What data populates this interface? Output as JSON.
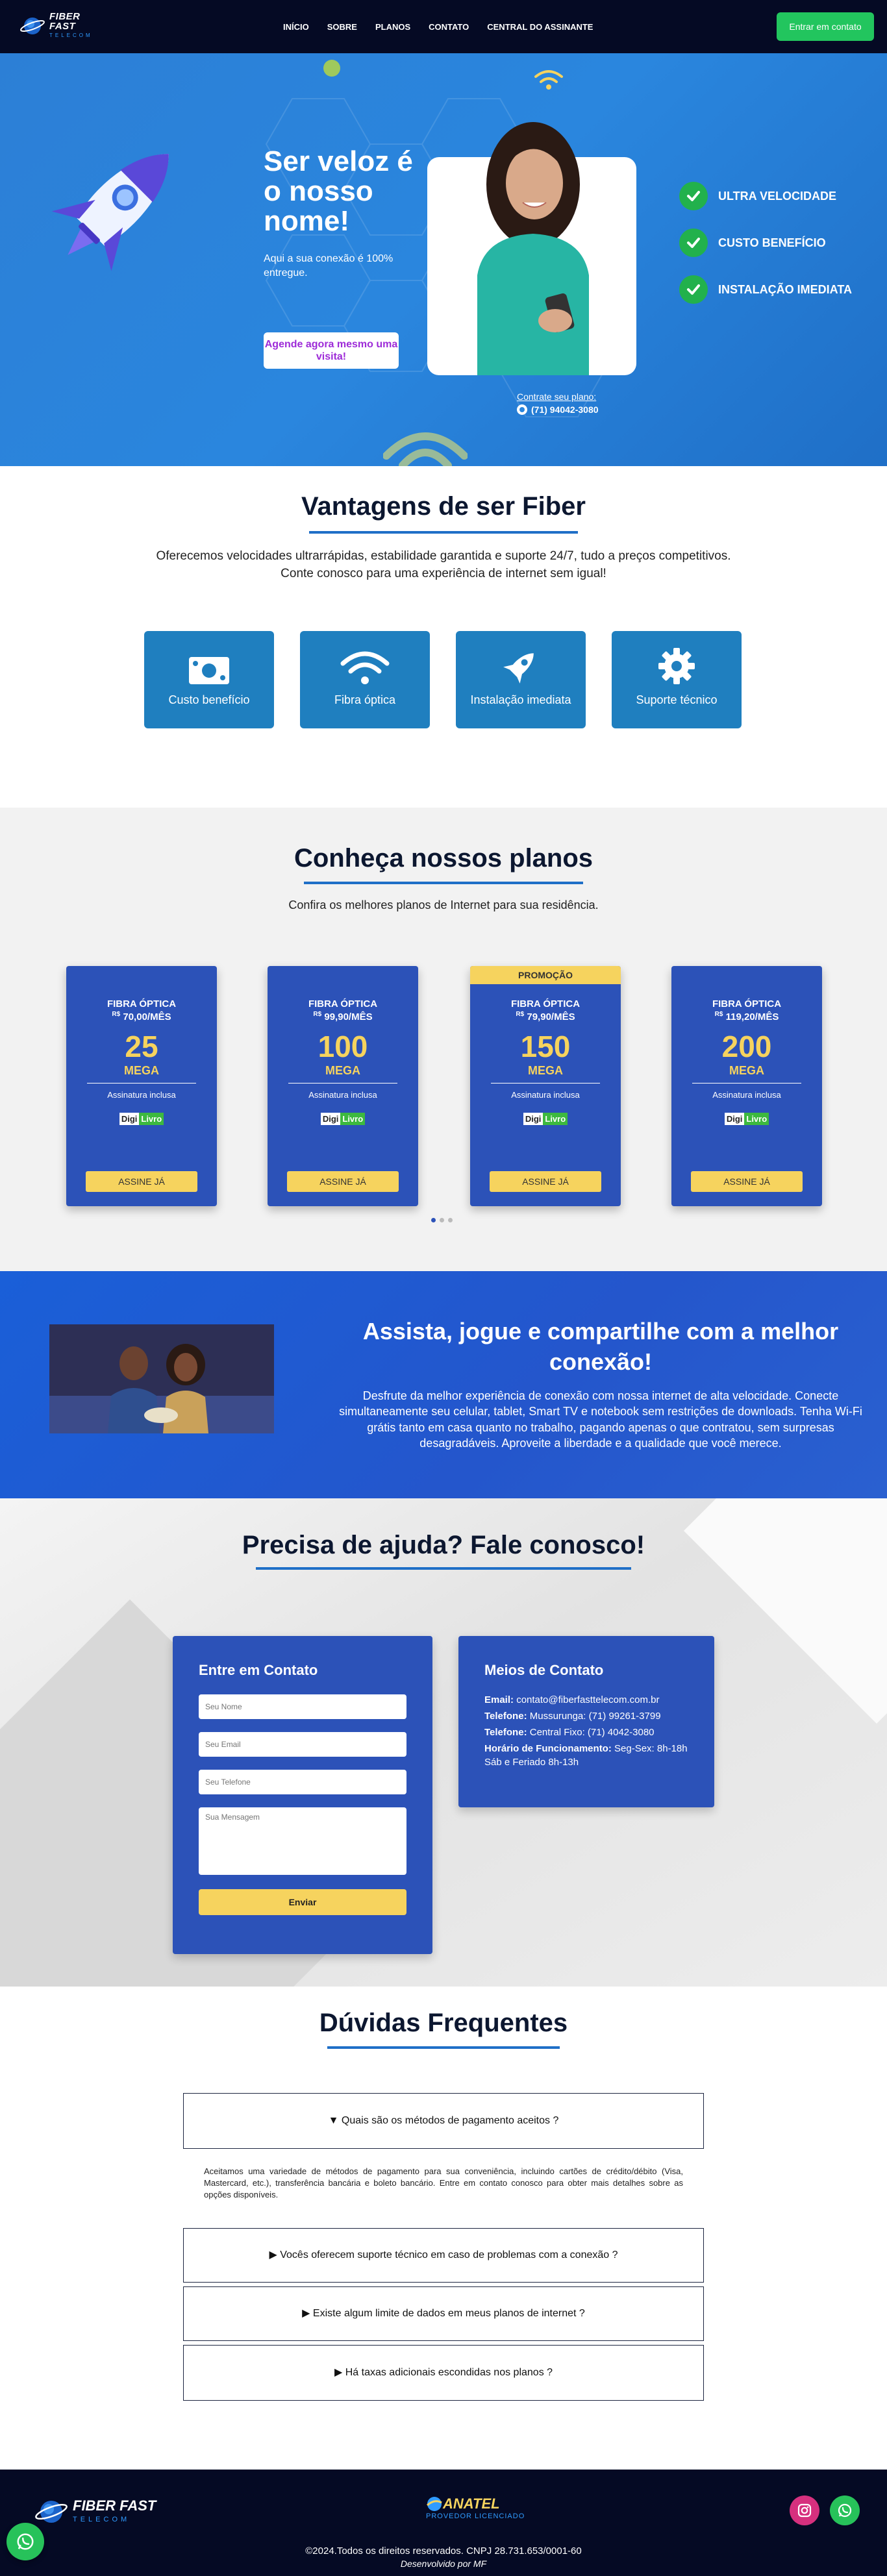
{
  "nav": {
    "logo_line1": "FIBER FAST",
    "logo_line2": "TELECOM",
    "links": [
      "INÍCIO",
      "SOBRE",
      "PLANOS",
      "CONTATO",
      "CENTRAL DO ASSINANTE"
    ],
    "cta": "Entrar em contato"
  },
  "hero": {
    "title": "Ser veloz é o nosso nome!",
    "subtitle": "Aqui a sua conexão é 100% entregue.",
    "button": "Agende agora mesmo uma visita!",
    "contract_label": "Contrate seu plano:",
    "phone": "(71) 94042-3080",
    "features": [
      "ULTRA VELOCIDADE",
      "CUSTO BENEFÍCIO",
      "INSTALAÇÃO IMEDIATA"
    ]
  },
  "vantagens": {
    "title": "Vantagens de ser Fiber",
    "text_line1": "Oferecemos velocidades ultrarrápidas, estabilidade garantida e suporte 24/7, tudo a preços competitivos.",
    "text_line2": "Conte conosco para uma experiência de internet sem igual!",
    "cards": [
      {
        "label": "Custo benefício",
        "icon": "money-icon"
      },
      {
        "label": "Fibra óptica",
        "icon": "wifi-icon"
      },
      {
        "label": "Instalação imediata",
        "icon": "rocket-icon"
      },
      {
        "label": "Suporte técnico",
        "icon": "gear-icon"
      }
    ]
  },
  "planos": {
    "title": "Conheça nossos planos",
    "subtitle": "Confira os melhores planos de Internet para sua residência.",
    "items": [
      {
        "type": "FIBRA ÓPTICA",
        "currency": "R$",
        "price": "70,00/MÊS",
        "speed": "25",
        "unit": "MEGA",
        "extra": "Assinatura inclusa",
        "digi1": "Digi",
        "digi2": "Livro",
        "button": "ASSINE JÁ",
        "promo": ""
      },
      {
        "type": "FIBRA ÓPTICA",
        "currency": "R$",
        "price": "99,90/MÊS",
        "speed": "100",
        "unit": "MEGA",
        "extra": "Assinatura inclusa",
        "digi1": "Digi",
        "digi2": "Livro",
        "button": "ASSINE JÁ",
        "promo": ""
      },
      {
        "type": "FIBRA ÓPTICA",
        "currency": "R$",
        "price": "79,90/MÊS",
        "speed": "150",
        "unit": "MEGA",
        "extra": "Assinatura inclusa",
        "digi1": "Digi",
        "digi2": "Livro",
        "button": "ASSINE JÁ",
        "promo": "PROMOÇÃO"
      },
      {
        "type": "FIBRA ÓPTICA",
        "currency": "R$",
        "price": "119,20/MÊS",
        "speed": "200",
        "unit": "MEGA",
        "extra": "Assinatura inclusa",
        "digi1": "Digi",
        "digi2": "Livro",
        "button": "ASSINE JÁ",
        "promo": ""
      }
    ]
  },
  "assista": {
    "title": "Assista, jogue e compartilhe com a melhor conexão!",
    "text": "Desfrute da melhor experiência de conexão com nossa internet de alta velocidade. Conecte simultaneamente seu celular, tablet, Smart TV e notebook sem restrições de downloads. Tenha Wi-Fi grátis tanto em casa quanto no trabalho, pagando apenas o que contratou, sem surpresas desagradáveis. Aproveite a liberdade e a qualidade que você merece."
  },
  "contato": {
    "title": "Precisa de ajuda? Fale conosco!",
    "form_title": "Entre em Contato",
    "placeholders": {
      "name": "Seu Nome",
      "email": "Seu Email",
      "phone": "Seu Telefone",
      "message": "Sua Mensagem"
    },
    "send": "Enviar",
    "info_title": "Meios de Contato",
    "email_label": "Email:",
    "email": "contato@fiberfasttelecom.com.br",
    "tel1_label": "Telefone:",
    "tel1": "Mussurunga: (71) 99261-3799",
    "tel2_label": "Telefone:",
    "tel2": "Central Fixo: (71) 4042-3080",
    "hours_label": "Horário de Funcionamento:",
    "hours": "Seg-Sex: 8h-18h",
    "hours2": "Sáb e Feriado 8h-13h"
  },
  "faq": {
    "title": "Dúvidas Frequentes",
    "q1": "▼ Quais são os métodos de pagamento aceitos ?",
    "a1": "Aceitamos uma variedade de métodos de pagamento para sua conveniência, incluindo cartões de crédito/débito (Visa, Mastercard, etc.), transferência bancária e boleto bancário. Entre em contato conosco para obter mais detalhes sobre as opções disponíveis.",
    "q2": "▶ Vocês oferecem suporte técnico em caso de problemas com a conexão ?",
    "q3": "▶ Existe algum limite de dados em meus planos de internet ?",
    "q4": "▶ Há taxas adicionais escondidas nos planos ?"
  },
  "footer": {
    "logo_line1": "FIBER FAST",
    "logo_line2": "TELECOM",
    "anatel1": "ANATEL",
    "anatel2": "PROVEDOR LICENCIADO",
    "copyright": "©2024.Todos os direitos reservados. CNPJ 28.731.653/0001-60",
    "dev": "Desenvolvido por MF"
  },
  "colors": {
    "navy": "#050a24",
    "hero_blue": "#2a86de",
    "card_blue": "#2c52b8",
    "yellow": "#f6d35e",
    "green": "#22c55e"
  }
}
